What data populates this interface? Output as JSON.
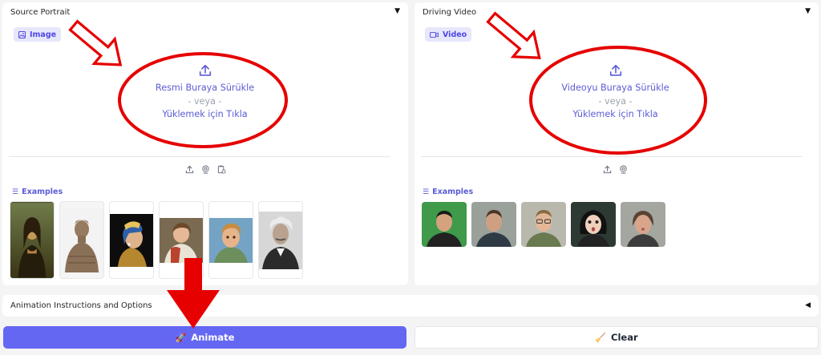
{
  "source_panel": {
    "title": "Source Portrait",
    "chip_label": "Image",
    "drop_line1": "Resmi Buraya Sürükle",
    "drop_or": "- veya -",
    "drop_line2": "Yüklemek için Tıkla",
    "source_icons": [
      "upload-icon",
      "webcam-icon",
      "clipboard-icon"
    ],
    "examples_label": "Examples",
    "examples": [
      {
        "name": "mona-lisa-thumbnail"
      },
      {
        "name": "terracotta-warrior-thumbnail"
      },
      {
        "name": "girl-with-pearl-earring-thumbnail"
      },
      {
        "name": "child-portrait-painting-thumbnail"
      },
      {
        "name": "animated-boy-thumbnail"
      },
      {
        "name": "einstein-photo-thumbnail"
      }
    ]
  },
  "video_panel": {
    "title": "Driving Video",
    "chip_label": "Video",
    "drop_line1": "Videoyu Buraya Sürükle",
    "drop_or": "- veya -",
    "drop_line2": "Yüklemek için Tıkla",
    "source_icons": [
      "upload-icon",
      "webcam-icon"
    ],
    "examples_label": "Examples",
    "examples": [
      {
        "name": "man-green-screen-thumbnail"
      },
      {
        "name": "man-grey-background-thumbnail"
      },
      {
        "name": "man-glasses-thumbnail"
      },
      {
        "name": "woman-surprised-thumbnail"
      },
      {
        "name": "woman-pursed-lips-thumbnail"
      }
    ]
  },
  "options": {
    "label": "Animation Instructions and Options"
  },
  "actions": {
    "animate_label": "Animate",
    "clear_label": "Clear"
  },
  "colors": {
    "accent": "#6467f2",
    "link_text": "#5b5bd6",
    "annotation_red": "#e60000"
  }
}
